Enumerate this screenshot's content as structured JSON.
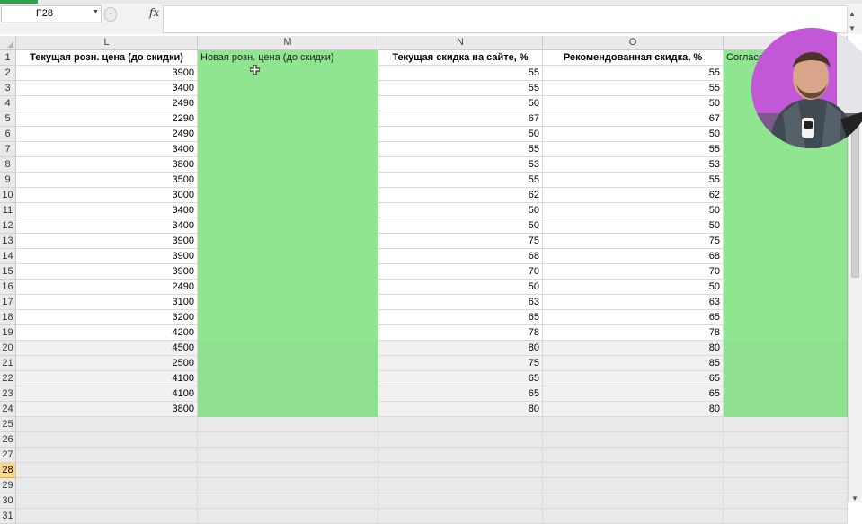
{
  "formula_bar": {
    "name_box": "F28",
    "fx_label": "fx",
    "formula": ""
  },
  "columns": [
    {
      "letter": "L",
      "header": "Текущая розн. цена (до скидки)"
    },
    {
      "letter": "M",
      "header": "Новая розн. цена (до скидки)"
    },
    {
      "letter": "N",
      "header": "Текущая скидка на сайте, %"
    },
    {
      "letter": "O",
      "header": "Рекомендованная скидка, %"
    },
    {
      "letter": "",
      "header": "Согласо"
    }
  ],
  "rows": [
    {
      "num": "2",
      "L": "3900",
      "N": "55",
      "O": "55"
    },
    {
      "num": "3",
      "L": "3400",
      "N": "55",
      "O": "55"
    },
    {
      "num": "4",
      "L": "2490",
      "N": "50",
      "O": "50"
    },
    {
      "num": "5",
      "L": "2290",
      "N": "67",
      "O": "67"
    },
    {
      "num": "6",
      "L": "2490",
      "N": "50",
      "O": "50"
    },
    {
      "num": "7",
      "L": "3400",
      "N": "55",
      "O": "55"
    },
    {
      "num": "8",
      "L": "3800",
      "N": "53",
      "O": "53"
    },
    {
      "num": "9",
      "L": "3500",
      "N": "55",
      "O": "55"
    },
    {
      "num": "10",
      "L": "3000",
      "N": "62",
      "O": "62"
    },
    {
      "num": "11",
      "L": "3400",
      "N": "50",
      "O": "50"
    },
    {
      "num": "12",
      "L": "3400",
      "N": "50",
      "O": "50"
    },
    {
      "num": "13",
      "L": "3900",
      "N": "75",
      "O": "75"
    },
    {
      "num": "14",
      "L": "3900",
      "N": "68",
      "O": "68"
    },
    {
      "num": "15",
      "L": "3900",
      "N": "70",
      "O": "70"
    },
    {
      "num": "16",
      "L": "2490",
      "N": "50",
      "O": "50"
    },
    {
      "num": "17",
      "L": "3100",
      "N": "63",
      "O": "63"
    },
    {
      "num": "18",
      "L": "3200",
      "N": "65",
      "O": "65"
    },
    {
      "num": "19",
      "L": "4200",
      "N": "78",
      "O": "78"
    },
    {
      "num": "20",
      "L": "4500",
      "N": "80",
      "O": "80"
    },
    {
      "num": "21",
      "L": "2500",
      "N": "75",
      "O": "85"
    },
    {
      "num": "22",
      "L": "4100",
      "N": "65",
      "O": "65"
    },
    {
      "num": "23",
      "L": "4100",
      "N": "65",
      "O": "65"
    },
    {
      "num": "24",
      "L": "3800",
      "N": "80",
      "O": "80"
    }
  ],
  "empty_rows": [
    "25",
    "26",
    "27",
    "28",
    "29",
    "30",
    "31"
  ],
  "header_row_num": "1",
  "selected_row": "28",
  "colors": {
    "green_fill": "#90e590",
    "selected_row_header": "#fbd78a"
  }
}
